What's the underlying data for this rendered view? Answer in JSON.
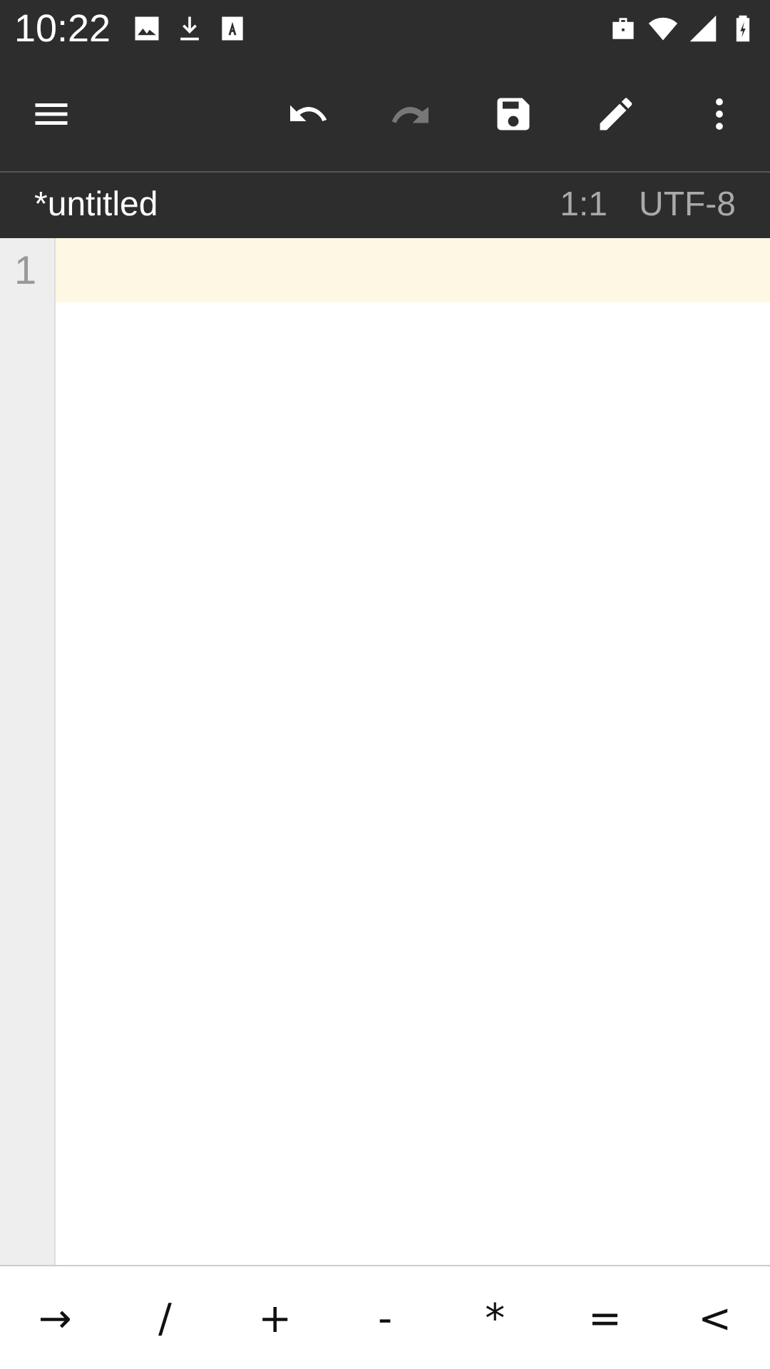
{
  "status_bar": {
    "time": "10:22",
    "notifications": [
      {
        "kind": "image"
      },
      {
        "kind": "download"
      },
      {
        "kind": "keyboard"
      }
    ],
    "indicators": [
      {
        "kind": "work"
      },
      {
        "kind": "wifi"
      },
      {
        "kind": "signal"
      },
      {
        "kind": "battery"
      }
    ]
  },
  "toolbar": {
    "buttons": [
      {
        "kind": "menu",
        "disabled": false
      },
      {
        "kind": "undo",
        "disabled": false
      },
      {
        "kind": "redo",
        "disabled": true
      },
      {
        "kind": "save",
        "disabled": false
      },
      {
        "kind": "edit",
        "disabled": false
      },
      {
        "kind": "more",
        "disabled": false
      }
    ]
  },
  "file_bar": {
    "filename": "*untitled",
    "cursor": "1:1",
    "encoding": "UTF-8"
  },
  "editor": {
    "lines": [
      {
        "number": "1",
        "current": true
      }
    ]
  },
  "symbol_bar": {
    "keys": [
      "→",
      "/",
      "+",
      "-",
      "*",
      "=",
      "<"
    ]
  }
}
